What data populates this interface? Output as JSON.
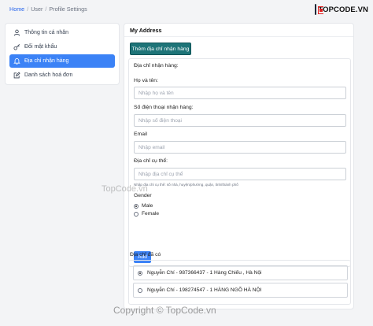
{
  "breadcrumb": {
    "home": "Home",
    "user": "User",
    "current": "Profile Settings",
    "separator": "/"
  },
  "logo": {
    "text": "TOPCODE.VN"
  },
  "sidebar": {
    "items": [
      {
        "label": "Thông tin cá nhân",
        "icon": "user-icon",
        "active": false
      },
      {
        "label": "Đổi mật khẩu",
        "icon": "key-icon",
        "active": false
      },
      {
        "label": "Địa chỉ nhận hàng",
        "icon": "bell-icon",
        "active": true
      },
      {
        "label": "Danh sách hoá đơn",
        "icon": "edit-icon",
        "active": false
      }
    ]
  },
  "panel": {
    "title": "My Address",
    "add_button": "Thêm địa chỉ nhận hàng",
    "form": {
      "section_title": "Địa chỉ nhận hàng:",
      "name_label": "Họ và tên:",
      "name_placeholder": "Nhập họ và tên",
      "phone_label": "Số điện thoại nhận hàng:",
      "phone_placeholder": "Nhập số điện thoại",
      "email_label": "Email",
      "email_placeholder": "Nhập email",
      "address_label": "Địa chỉ cụ thể:",
      "address_placeholder": "Nhập địa chỉ cụ thể",
      "address_hint": "Nhập địa chỉ cụ thể: số nhà, huyện/phường, quận, tỉnh/thành phố",
      "gender_label": "Gender",
      "gender_options": [
        {
          "label": "Male",
          "checked": true
        },
        {
          "label": "Female",
          "checked": false
        }
      ],
      "submit_label": "Add"
    },
    "saved_title": "Địa chỉ đã có",
    "saved_addresses": [
      {
        "text": "Nguyễn Chí - 987366437 - 1 Hàng Chiếu , Hà Nội",
        "checked": true
      },
      {
        "text": "Nguyễn Chí - 198274547 - 1 HÀNG NGÕ HÀ NỘI",
        "checked": false
      }
    ]
  },
  "watermarks": {
    "center": "TopCode.vn",
    "bottom": "Copyright © TopCode.vn"
  },
  "colors": {
    "primary": "#3b82f6",
    "teal_button": "#1e7478",
    "link": "#2563eb",
    "logo_red": "#e11d1d"
  }
}
